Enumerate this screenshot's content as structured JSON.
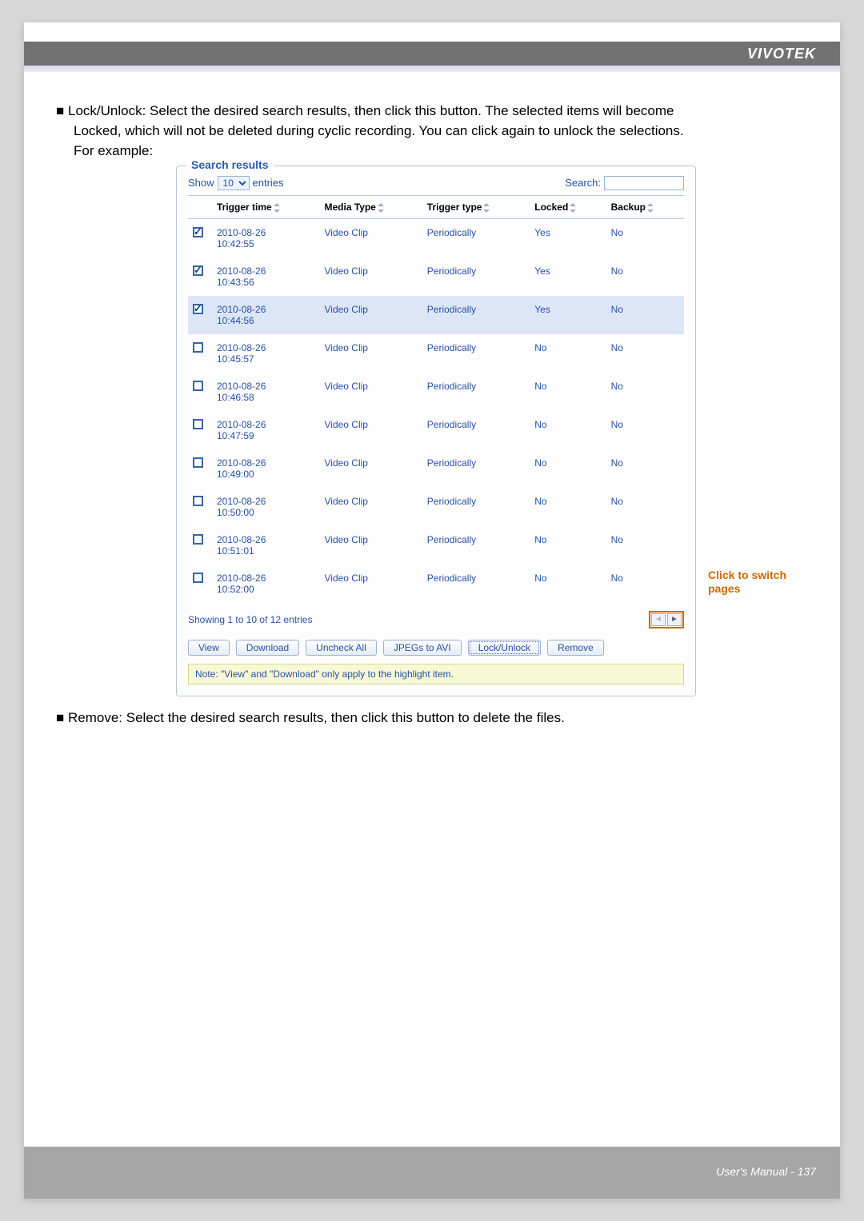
{
  "brand": "VIVOTEK",
  "bullets": {
    "bullet1a": "■ Lock/Unlock: Select the desired search results, then click this button. The selected items will become",
    "bullet1b": "Locked, which will not be deleted during cyclic recording. You can click again to unlock the selections.",
    "bullet1c": "For example:",
    "bullet2": "■ Remove: Select the desired search results, then click this button to delete the files."
  },
  "results": {
    "legend": "Search results",
    "show_label": "Show",
    "entries_label": "entries",
    "entries_value": "10",
    "search_label": "Search:",
    "headers": {
      "trigger_time": "Trigger time",
      "media_type": "Media Type",
      "trigger_type": "Trigger type",
      "locked": "Locked",
      "backup": "Backup"
    },
    "rows": [
      {
        "checked": true,
        "selected": false,
        "time": "2010-08-26 10:42:55",
        "media": "Video Clip",
        "trigger": "Periodically",
        "locked": "Yes",
        "backup": "No"
      },
      {
        "checked": true,
        "selected": false,
        "time": "2010-08-26 10:43:56",
        "media": "Video Clip",
        "trigger": "Periodically",
        "locked": "Yes",
        "backup": "No"
      },
      {
        "checked": true,
        "selected": true,
        "time": "2010-08-26 10:44:56",
        "media": "Video Clip",
        "trigger": "Periodically",
        "locked": "Yes",
        "backup": "No"
      },
      {
        "checked": false,
        "selected": false,
        "time": "2010-08-26 10:45:57",
        "media": "Video Clip",
        "trigger": "Periodically",
        "locked": "No",
        "backup": "No"
      },
      {
        "checked": false,
        "selected": false,
        "time": "2010-08-26 10:46:58",
        "media": "Video Clip",
        "trigger": "Periodically",
        "locked": "No",
        "backup": "No"
      },
      {
        "checked": false,
        "selected": false,
        "time": "2010-08-26 10:47:59",
        "media": "Video Clip",
        "trigger": "Periodically",
        "locked": "No",
        "backup": "No"
      },
      {
        "checked": false,
        "selected": false,
        "time": "2010-08-26 10:49:00",
        "media": "Video Clip",
        "trigger": "Periodically",
        "locked": "No",
        "backup": "No"
      },
      {
        "checked": false,
        "selected": false,
        "time": "2010-08-26 10:50:00",
        "media": "Video Clip",
        "trigger": "Periodically",
        "locked": "No",
        "backup": "No"
      },
      {
        "checked": false,
        "selected": false,
        "time": "2010-08-26 10:51:01",
        "media": "Video Clip",
        "trigger": "Periodically",
        "locked": "No",
        "backup": "No"
      },
      {
        "checked": false,
        "selected": false,
        "time": "2010-08-26 10:52:00",
        "media": "Video Clip",
        "trigger": "Periodically",
        "locked": "No",
        "backup": "No"
      }
    ],
    "showing": "Showing 1 to 10 of 12 entries",
    "buttons": {
      "view": "View",
      "download": "Download",
      "uncheck_all": "Uncheck All",
      "jpegs_to_avi": "JPEGs to AVI",
      "lock_unlock": "Lock/Unlock",
      "remove": "Remove"
    },
    "note": "Note: \"View\" and \"Download\" only apply to the highlight item."
  },
  "switch_label": "Click to switch pages",
  "footer": "User's Manual - 137"
}
